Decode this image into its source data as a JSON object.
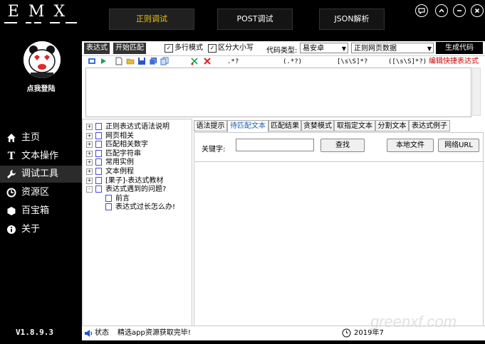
{
  "app": {
    "logo_text": "EMX",
    "login_text": "点我登陆",
    "version": "V1.8.9.3"
  },
  "nav": [
    {
      "label": "主页",
      "icon": "home-icon"
    },
    {
      "label": "文本操作",
      "icon": "text-icon"
    },
    {
      "label": "调试工具",
      "icon": "wrench-icon"
    },
    {
      "label": "资源区",
      "icon": "clock-icon"
    },
    {
      "label": "百宝箱",
      "icon": "hexagon-icon"
    },
    {
      "label": "关于",
      "icon": "info-icon"
    }
  ],
  "top_tabs": [
    "正则调试",
    "POST调试",
    "JSON解析"
  ],
  "toolbar": {
    "mode_expr": "表达式",
    "mode_match": "开始匹配",
    "multiline": "多行模式",
    "case_sensitive": "区分大小写",
    "code_type_label": "代码类型:",
    "code_type_value": "易安卓",
    "web_source_value": "正则网页数据",
    "generate_button": "生成代码"
  },
  "snippets": {
    "s1": ".*?",
    "s2": "(.*?)",
    "s3": "[\\s\\S]*?",
    "s4": "([\\s\\S]*?)",
    "link": "编辑快捷表达式"
  },
  "tree": [
    {
      "label": "正则表达式语法说明",
      "expander": "+"
    },
    {
      "label": "网页相关",
      "expander": "+"
    },
    {
      "label": "匹配相关数字",
      "expander": "+"
    },
    {
      "label": "匹配字符串",
      "expander": "+"
    },
    {
      "label": "常用实例",
      "expander": "+"
    },
    {
      "label": "文本例程",
      "expander": "+"
    },
    {
      "label": "[果子]-表达式教材",
      "expander": "+"
    },
    {
      "label": "表达式遇到的问题?",
      "expander": "-"
    },
    {
      "label": "前言",
      "expander": ""
    },
    {
      "label": "表达式过长怎么办!",
      "expander": ""
    }
  ],
  "right_tabs": [
    "语法提示",
    "待匹配文本",
    "匹配结果",
    "贪婪模式",
    "取指定文本",
    "分割文本",
    "表达式例子"
  ],
  "panel": {
    "keyword_label": "关键字:",
    "keyword_value": "",
    "find_button": "查找",
    "local_file_button": "本地文件",
    "web_url_button": "网络URL"
  },
  "status": {
    "label": "状态",
    "message": "精选app资源获取完毕!",
    "date": "2019年7"
  },
  "watermark": "greenxf.com",
  "colors": {
    "accent_tab": "#f1c40f",
    "sidebar_bg": "#000000",
    "link_red": "#cc0000"
  }
}
